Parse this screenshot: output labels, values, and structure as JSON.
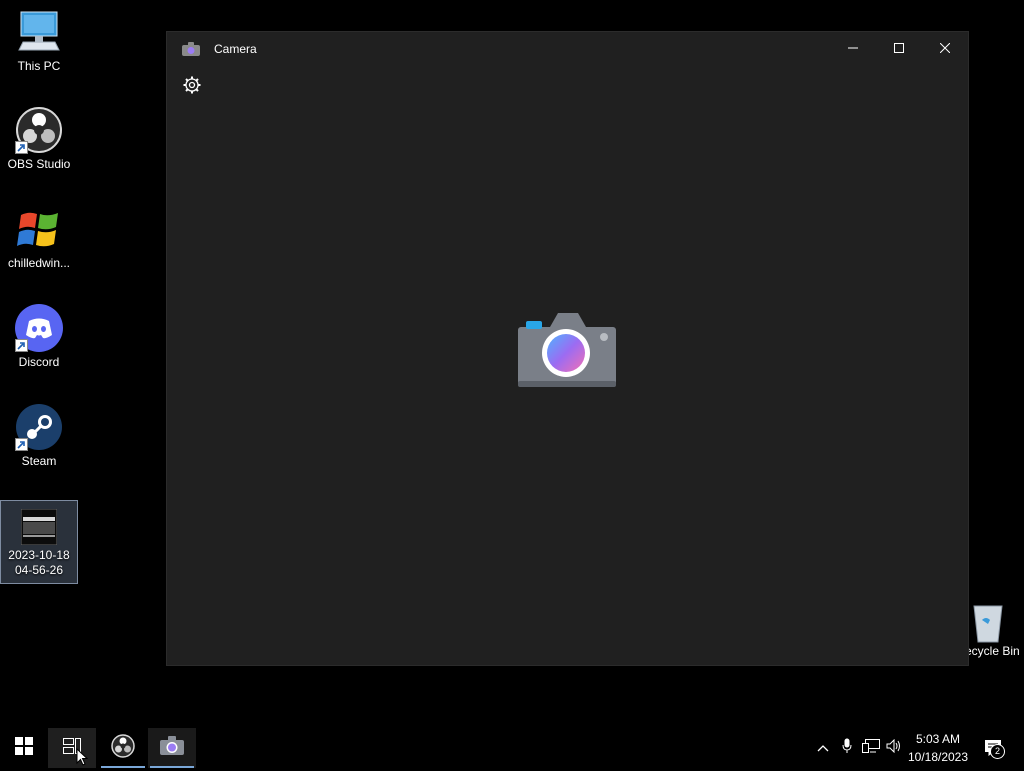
{
  "desktop": {
    "icons": [
      {
        "label": "This PC"
      },
      {
        "label": "OBS Studio"
      },
      {
        "label": "chilledwin..."
      },
      {
        "label": "Discord"
      },
      {
        "label": "Steam"
      },
      {
        "label": "2023-10-18 04-56-26"
      }
    ],
    "recycle_bin_label": "Recycle Bin"
  },
  "window": {
    "title": "Camera",
    "icon": "camera-icon",
    "controls": [
      "minimize-icon",
      "maximize-icon",
      "close-icon"
    ],
    "settings_icon": "gear-icon"
  },
  "taskbar": {
    "buttons": [
      "start",
      "task-view",
      "obs-studio",
      "camera"
    ],
    "tray_icons": [
      "chevron-up-icon",
      "microphone-icon",
      "network-icon",
      "volume-icon"
    ],
    "time": "5:03 AM",
    "date": "10/18/2023",
    "notification_count": "2"
  },
  "colors": {
    "window_bg": "#202020",
    "desktop_bg": "#000000",
    "accent": "#7aa7d8"
  }
}
